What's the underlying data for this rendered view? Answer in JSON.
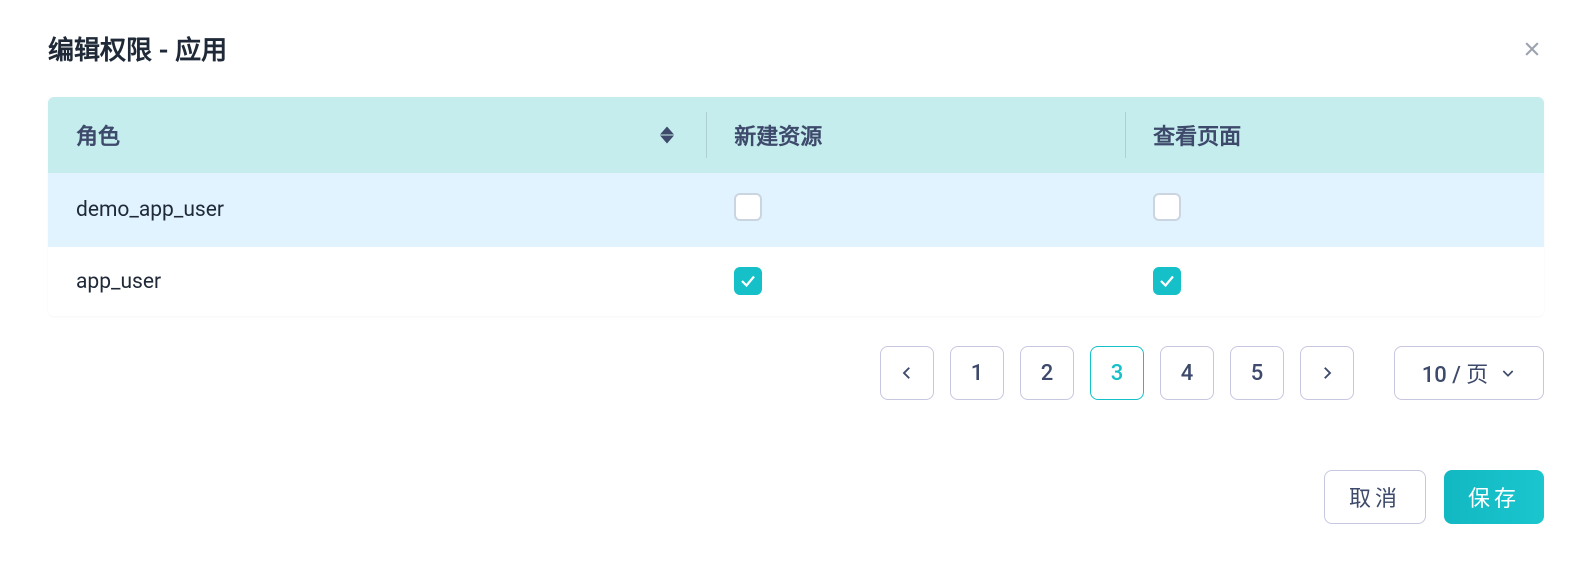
{
  "modal": {
    "title": "编辑权限 - 应用"
  },
  "table": {
    "columns": {
      "role": "角色",
      "create": "新建资源",
      "view": "查看页面"
    },
    "rows": [
      {
        "role": "demo_app_user",
        "create": false,
        "view": false,
        "highlight": true
      },
      {
        "role": "app_user",
        "create": true,
        "view": true,
        "highlight": false
      }
    ]
  },
  "pagination": {
    "pages": [
      "1",
      "2",
      "3",
      "4",
      "5"
    ],
    "active": "3",
    "page_size_label": "10 / 页"
  },
  "footer": {
    "cancel": "取消",
    "save": "保存"
  }
}
